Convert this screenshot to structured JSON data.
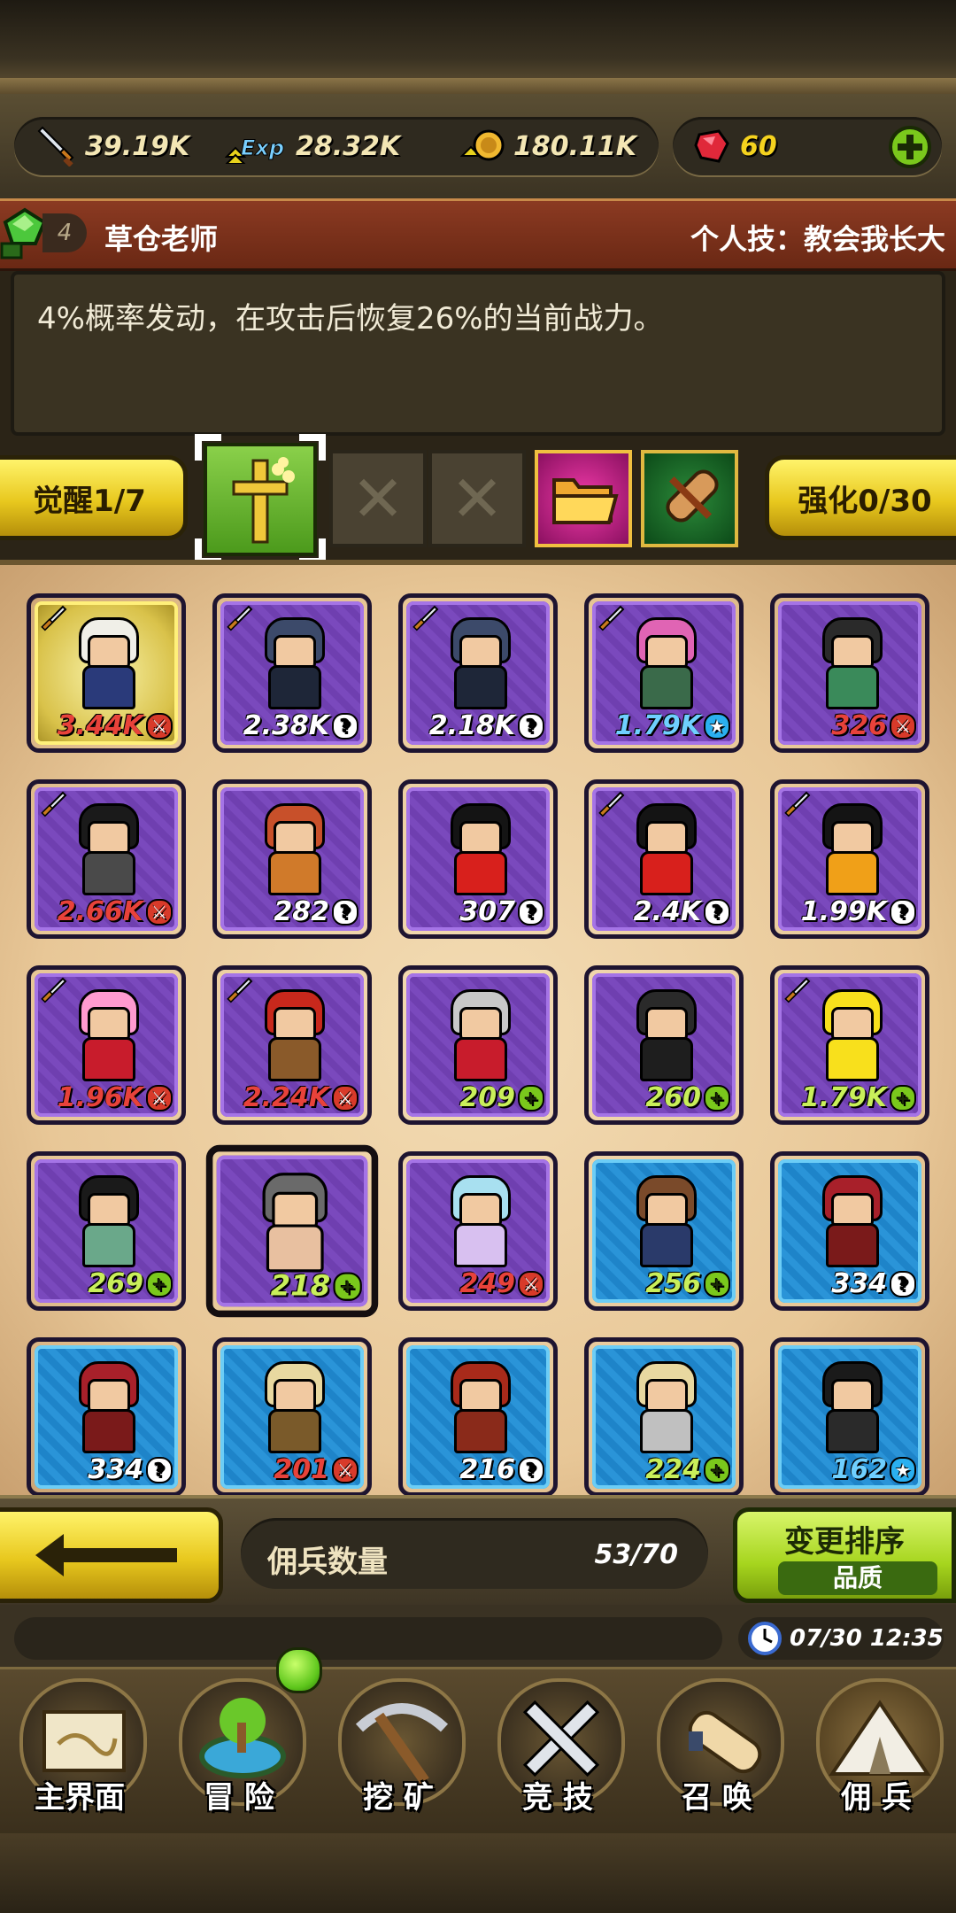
{
  "resources": {
    "attack": "39.19K",
    "exp": "28.32K",
    "gold": "180.11K",
    "gems": "60"
  },
  "hero": {
    "level": "4",
    "name": "草仓老师",
    "skill": "个人技：教会我长大",
    "description": "4%概率发动，在攻击后恢复26%的当前战力。"
  },
  "awaken": {
    "label": "觉醒1/7"
  },
  "enhance": {
    "label": "强化0/30"
  },
  "cards": [
    {
      "power": "3.44K",
      "badge": "attack",
      "rarity": "gold",
      "sword": true,
      "hair": "#f0efe8",
      "body": "#2a3a7a"
    },
    {
      "power": "2.38K",
      "badge": "question",
      "rarity": "purple",
      "sword": true,
      "hair": "#3c4a6a",
      "body": "#1e2638"
    },
    {
      "power": "2.18K",
      "badge": "question",
      "rarity": "purple",
      "sword": true,
      "hair": "#3c4a6a",
      "body": "#1e2638"
    },
    {
      "power": "1.79K",
      "badge": "star",
      "rarity": "purple",
      "sword": true,
      "hair": "#e064b4",
      "body": "#3a6a4a"
    },
    {
      "power": "326",
      "badge": "attack",
      "rarity": "purple",
      "sword": false,
      "hair": "#2a2a2a",
      "body": "#3a8a5a"
    },
    {
      "power": "2.66K",
      "badge": "attack",
      "rarity": "purple",
      "sword": true,
      "hair": "#1a1a1a",
      "body": "#4a4a4a"
    },
    {
      "power": "282",
      "badge": "question",
      "rarity": "purple",
      "sword": false,
      "hair": "#c8502a",
      "body": "#d07a2a"
    },
    {
      "power": "307",
      "badge": "question",
      "rarity": "purple",
      "sword": false,
      "hair": "#141414",
      "body": "#d8201c"
    },
    {
      "power": "2.4K",
      "badge": "question",
      "rarity": "purple",
      "sword": true,
      "hair": "#141414",
      "body": "#d8201c"
    },
    {
      "power": "1.99K",
      "badge": "question",
      "rarity": "purple",
      "sword": true,
      "hair": "#141414",
      "body": "#f0a018"
    },
    {
      "power": "1.96K",
      "badge": "attack",
      "rarity": "purple",
      "sword": true,
      "hair": "#ff9ad0",
      "body": "#c81c2c"
    },
    {
      "power": "2.24K",
      "badge": "attack",
      "rarity": "purple",
      "sword": true,
      "hair": "#c8281c",
      "body": "#8a5a2a"
    },
    {
      "power": "209",
      "badge": "plus",
      "rarity": "purple",
      "sword": false,
      "hair": "#c8c8c8",
      "body": "#c81c2c"
    },
    {
      "power": "260",
      "badge": "plus",
      "rarity": "purple",
      "sword": false,
      "hair": "#2a2a2a",
      "body": "#1e1e1e"
    },
    {
      "power": "1.79K",
      "badge": "plus",
      "rarity": "purple",
      "sword": true,
      "hair": "#f8e01c",
      "body": "#f8e01c"
    },
    {
      "power": "269",
      "badge": "plus",
      "rarity": "purple",
      "sword": false,
      "hair": "#1a1a1a",
      "body": "#6aa88a"
    },
    {
      "power": "218",
      "badge": "plus",
      "rarity": "purple",
      "sword": false,
      "hair": "#6a6a6a",
      "body": "#e8c0a0",
      "selected": true
    },
    {
      "power": "249",
      "badge": "attack",
      "rarity": "purple",
      "sword": false,
      "hair": "#a8e0f0",
      "body": "#d8c0f0"
    },
    {
      "power": "256",
      "badge": "plus",
      "rarity": "blue",
      "sword": false,
      "hair": "#7a4a2a",
      "body": "#2a3a6a"
    },
    {
      "power": "334",
      "badge": "question",
      "rarity": "blue",
      "sword": false,
      "hair": "#a8202a",
      "body": "#7a1a1a"
    },
    {
      "power": "334",
      "badge": "question",
      "rarity": "blue",
      "sword": false,
      "hair": "#a8202a",
      "body": "#7a1a1a"
    },
    {
      "power": "201",
      "badge": "attack",
      "rarity": "blue",
      "sword": false,
      "hair": "#e8d8a0",
      "body": "#7a5a2a"
    },
    {
      "power": "216",
      "badge": "question",
      "rarity": "blue",
      "sword": false,
      "hair": "#a82a1a",
      "body": "#8a2a1a"
    },
    {
      "power": "224",
      "badge": "plus",
      "rarity": "blue",
      "sword": false,
      "hair": "#e8d8a0",
      "body": "#c0c0c0"
    },
    {
      "power": "162",
      "badge": "star",
      "rarity": "blue",
      "sword": false,
      "hair": "#1a1a1a",
      "body": "#2a2a2a"
    }
  ],
  "controls": {
    "count_label": "佣兵数量",
    "count_value": "53/70",
    "sort_label": "变更排序",
    "sort_mode": "品质"
  },
  "status": {
    "datetime": "07/30 12:35"
  },
  "nav": [
    "主界面",
    "冒 险",
    "挖 矿",
    "竞 技",
    "召 唤",
    "佣 兵"
  ],
  "colors": {
    "power_gold_red": "#e8423a",
    "power_default": "#ffffff",
    "power_star": "#6fd0ff",
    "power_plus": "#c9ef5a"
  }
}
